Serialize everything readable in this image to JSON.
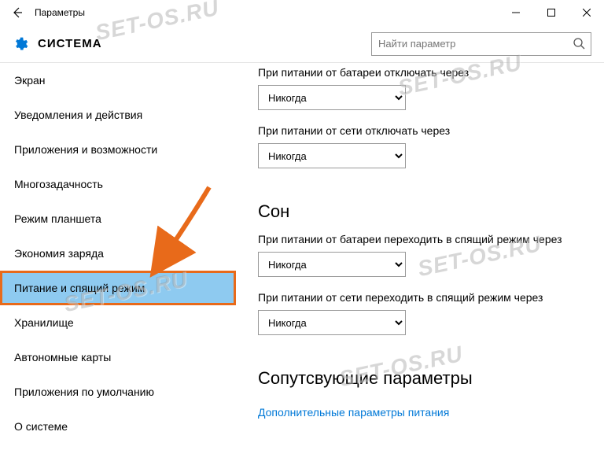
{
  "window": {
    "title": "Параметры"
  },
  "header": {
    "heading": "СИСТЕМА",
    "search_placeholder": "Найти параметр"
  },
  "sidebar": {
    "items": [
      {
        "label": "Экран"
      },
      {
        "label": "Уведомления и действия"
      },
      {
        "label": "Приложения и возможности"
      },
      {
        "label": "Многозадачность"
      },
      {
        "label": "Режим планшета"
      },
      {
        "label": "Экономия заряда"
      },
      {
        "label": "Питание и спящий режим",
        "selected": true
      },
      {
        "label": "Хранилище"
      },
      {
        "label": "Автономные карты"
      },
      {
        "label": "Приложения по умолчанию"
      },
      {
        "label": "О системе"
      }
    ]
  },
  "content": {
    "screen_off_battery_label": "При питании от батареи отключать через",
    "screen_off_battery_value": "Никогда",
    "screen_off_ac_label": "При питании от сети отключать через",
    "screen_off_ac_value": "Никогда",
    "sleep_heading": "Сон",
    "sleep_battery_label": "При питании от батареи переходить в спящий режим через",
    "sleep_battery_value": "Никогда",
    "sleep_ac_label": "При питании от сети переходить в спящий режим через",
    "sleep_ac_value": "Никогда",
    "related_heading": "Сопутсвующие параметры",
    "related_link": "Дополнительные параметры питания"
  },
  "watermark": "SET-OS.RU"
}
